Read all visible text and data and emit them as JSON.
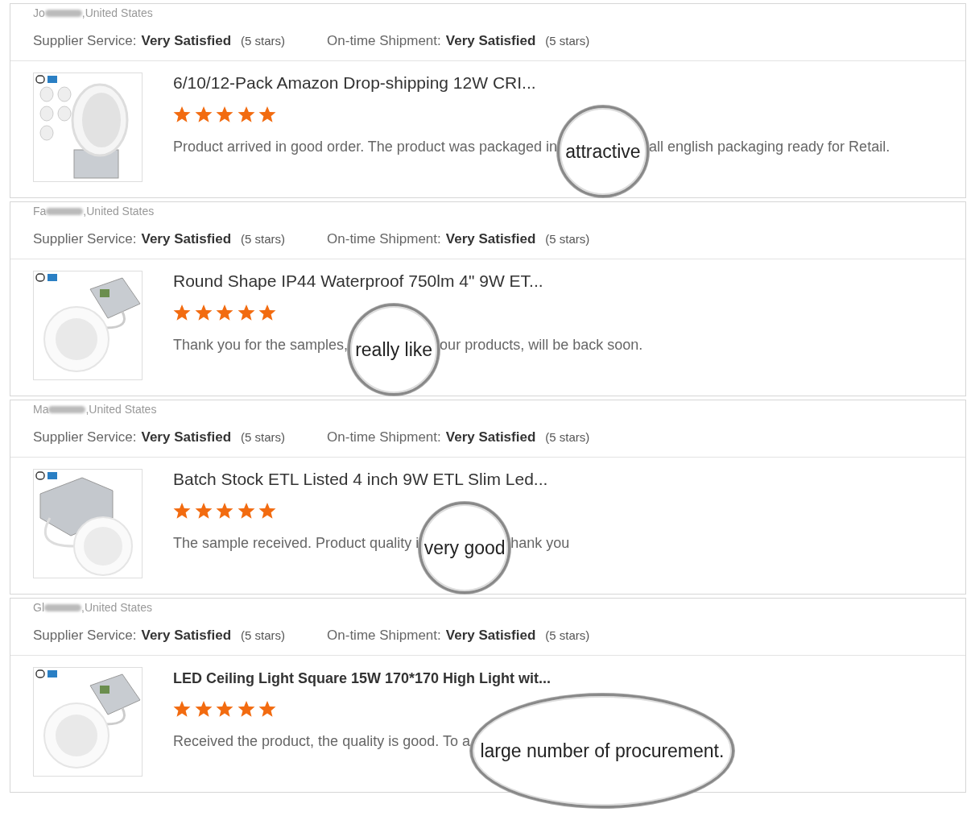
{
  "reviews": [
    {
      "name_prefix": "Jo",
      "location": ",United States",
      "ratings": [
        {
          "label": "Supplier Service:",
          "value": "Very Satisfied",
          "count": "(5 stars)"
        },
        {
          "label": "On-time Shipment:",
          "value": "Very Satisfied",
          "count": "(5 stars)"
        }
      ],
      "product": {
        "title": "6/10/12-Pack Amazon Drop-shipping 12W CRI...",
        "stars": 5,
        "comment_before": "Product arrived in good order. The product was packaged in",
        "magnified": "attractive",
        "comment_after": "all english packaging ready for Retail."
      }
    },
    {
      "name_prefix": "Fa",
      "location": ",United States",
      "ratings": [
        {
          "label": "Supplier Service:",
          "value": "Very Satisfied",
          "count": "(5 stars)"
        },
        {
          "label": "On-time Shipment:",
          "value": "Very Satisfied",
          "count": "(5 stars)"
        }
      ],
      "product": {
        "title": "Round Shape IP44 Waterproof 750lm 4\" 9W ET...",
        "stars": 5,
        "comment_before": "Thank you for the samples,",
        "magnified": "really like",
        "comment_after": "our products, will be back soon."
      }
    },
    {
      "name_prefix": "Ma",
      "location": ",United States",
      "ratings": [
        {
          "label": "Supplier Service:",
          "value": "Very Satisfied",
          "count": "(5 stars)"
        },
        {
          "label": "On-time Shipment:",
          "value": "Very Satisfied",
          "count": "(5 stars)"
        }
      ],
      "product": {
        "title": "Batch Stock ETL Listed 4 inch 9W ETL Slim Led...",
        "stars": 5,
        "comment_before": "The sample received. Product quality i",
        "magnified": "very good",
        "comment_after": "hank you"
      }
    },
    {
      "name_prefix": "Gl",
      "location": ",United States",
      "ratings": [
        {
          "label": "Supplier Service:",
          "value": "Very Satisfied",
          "count": "(5 stars)"
        },
        {
          "label": "On-time Shipment:",
          "value": "Very Satisfied",
          "count": "(5 stars)"
        }
      ],
      "product": {
        "title": "LED Ceiling Light Square 15W 170*170 High Light wit...",
        "stars": 5,
        "comment_before": "Received the product, the quality is good. To a",
        "magnified": "large number of procurement."
      }
    }
  ]
}
